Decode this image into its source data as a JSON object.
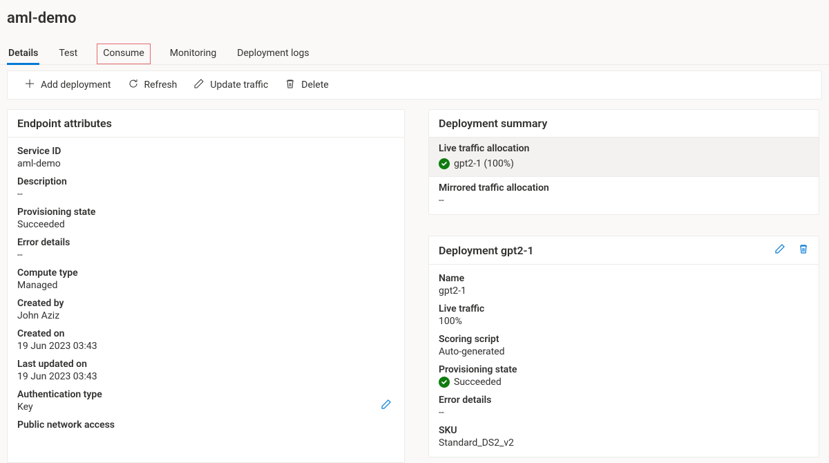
{
  "page": {
    "title": "aml-demo"
  },
  "tabs": {
    "details": "Details",
    "test": "Test",
    "consume": "Consume",
    "monitoring": "Monitoring",
    "logs": "Deployment logs"
  },
  "toolbar": {
    "add": "Add deployment",
    "refresh": "Refresh",
    "update": "Update traffic",
    "delete": "Delete"
  },
  "endpoint": {
    "header": "Endpoint attributes",
    "serviceId": {
      "label": "Service ID",
      "value": "aml-demo"
    },
    "description": {
      "label": "Description",
      "value": "--"
    },
    "provisioning": {
      "label": "Provisioning state",
      "value": "Succeeded"
    },
    "errorDetails": {
      "label": "Error details",
      "value": "--"
    },
    "computeType": {
      "label": "Compute type",
      "value": "Managed"
    },
    "createdBy": {
      "label": "Created by",
      "value": "John Aziz"
    },
    "createdOn": {
      "label": "Created on",
      "value": "19 Jun 2023 03:43"
    },
    "lastUpdated": {
      "label": "Last updated on",
      "value": "19 Jun 2023 03:43"
    },
    "authType": {
      "label": "Authentication type",
      "value": "Key"
    },
    "publicNetwork": {
      "label": "Public network access"
    }
  },
  "summary": {
    "header": "Deployment summary",
    "liveTitle": "Live traffic allocation",
    "liveValue": "gpt2-1 (100%)",
    "mirroredTitle": "Mirrored traffic allocation",
    "mirroredValue": "--"
  },
  "deployment": {
    "header": "Deployment gpt2-1",
    "name": {
      "label": "Name",
      "value": "gpt2-1"
    },
    "liveTraffic": {
      "label": "Live traffic",
      "value": "100%"
    },
    "scoring": {
      "label": "Scoring script",
      "value": "Auto-generated"
    },
    "provisioning": {
      "label": "Provisioning state",
      "value": "Succeeded"
    },
    "errorDetails": {
      "label": "Error details",
      "value": "--"
    },
    "sku": {
      "label": "SKU",
      "value": "Standard_DS2_v2"
    }
  }
}
